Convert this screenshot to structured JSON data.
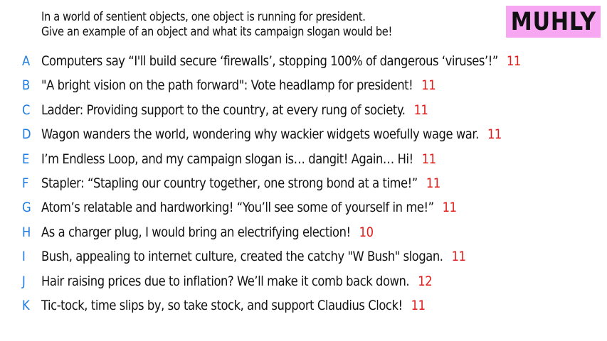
{
  "prompt": {
    "line1": "In a world of sentient objects, one object is running for president.",
    "line2": "Give an example of an object and what its campaign slogan would be!"
  },
  "badge": {
    "label": "MUHLY",
    "color": "#f7a7f2"
  },
  "colors": {
    "letter": "#1e7be0",
    "score": "#e21b1b",
    "text": "#111111"
  },
  "answers": [
    {
      "letter": "A",
      "text": "Computers say “I'll build secure ‘firewalls’, stopping 100% of dangerous ‘viruses’!”",
      "score": "11"
    },
    {
      "letter": "B",
      "text": "\"A bright vision on the path forward\": Vote headlamp for president!",
      "score": "11"
    },
    {
      "letter": "C",
      "text": "Ladder: Providing support to the country, at every rung of society.",
      "score": "11"
    },
    {
      "letter": "D",
      "text": "Wagon wanders the world, wondering why wackier widgets woefully wage war.",
      "score": "11"
    },
    {
      "letter": "E",
      "text": "I’m Endless Loop, and my campaign slogan is… dangit! Again… Hi!",
      "score": "11"
    },
    {
      "letter": "F",
      "text": "Stapler: “Stapling our country together, one strong bond at a time!”",
      "score": "11"
    },
    {
      "letter": "G",
      "text": "Atom’s relatable and hardworking! “You’ll see some of yourself in me!”",
      "score": "11"
    },
    {
      "letter": "H",
      "text": "As a charger plug, I would bring an electrifying election!",
      "score": "10"
    },
    {
      "letter": "I",
      "text": "Bush, appealing to internet culture, created the catchy \"W Bush\" slogan.",
      "score": "11"
    },
    {
      "letter": "J",
      "text": "Hair raising prices due to inflation? We’ll make it comb back down.",
      "score": "12"
    },
    {
      "letter": "K",
      "text": "Tic-tock, time slips by, so take stock, and support Claudius Clock!",
      "score": "11"
    }
  ]
}
